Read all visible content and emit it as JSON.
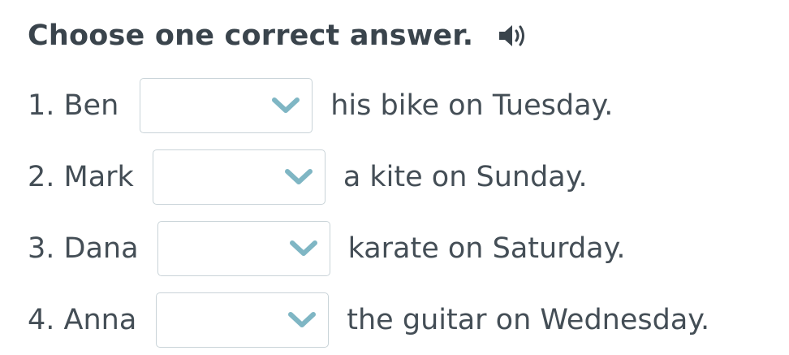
{
  "header": {
    "title": "Choose one correct answer.",
    "audio_icon": "speaker-icon"
  },
  "questions": [
    {
      "lead": "1. Ben",
      "selected": "",
      "tail": "his bike on Tuesday."
    },
    {
      "lead": "2. Mark",
      "selected": "",
      "tail": "a kite on Sunday."
    },
    {
      "lead": "3. Dana",
      "selected": "",
      "tail": "karate on Saturday."
    },
    {
      "lead": "4. Anna",
      "selected": "",
      "tail": "the guitar on Wednesday."
    }
  ],
  "colors": {
    "text": "#444e56",
    "title": "#3a444c",
    "border": "#c9d3d8",
    "chevron": "#7fb6c4"
  }
}
